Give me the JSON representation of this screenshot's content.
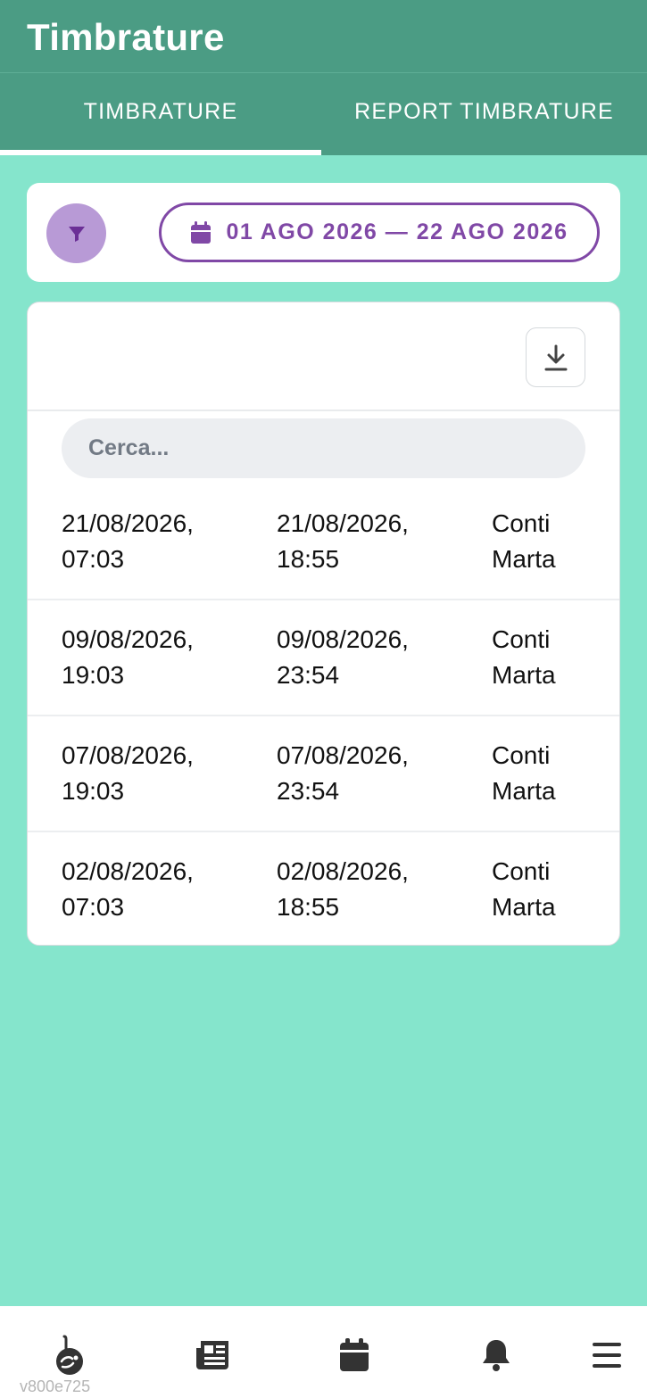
{
  "header": {
    "title": "Timbrature"
  },
  "tabs": [
    {
      "label": "TIMBRATURE",
      "active": true
    },
    {
      "label": "REPORT TIMBRATURE",
      "active": false
    }
  ],
  "filter": {
    "filter_icon": "filter-icon",
    "date_range": "01 AGO 2026 — 22 AGO 2026",
    "calendar_icon": "calendar-icon"
  },
  "list": {
    "download_icon": "download-icon",
    "search_placeholder": "Cerca...",
    "rows": [
      {
        "start_date": "21/08/2026,",
        "start_time": "07:03",
        "end_date": "21/08/2026,",
        "end_time": "18:55",
        "surname": "Conti",
        "name": "Marta"
      },
      {
        "start_date": "09/08/2026,",
        "start_time": "19:03",
        "end_date": "09/08/2026,",
        "end_time": "23:54",
        "surname": "Conti",
        "name": "Marta"
      },
      {
        "start_date": "07/08/2026,",
        "start_time": "19:03",
        "end_date": "07/08/2026,",
        "end_time": "23:54",
        "surname": "Conti",
        "name": "Marta"
      },
      {
        "start_date": "02/08/2026,",
        "start_time": "07:03",
        "end_date": "02/08/2026,",
        "end_time": "18:55",
        "surname": "Conti",
        "name": "Marta"
      }
    ]
  },
  "bottom_nav": {
    "items": [
      "home-hand-icon",
      "news-icon",
      "calendar-icon",
      "bell-icon",
      "menu-icon"
    ]
  },
  "version": "v800e725",
  "colors": {
    "background": "#85e5cc",
    "header": "#4b9c84",
    "accent_purple": "#8048a6",
    "filter_button": "#b89ad6"
  }
}
